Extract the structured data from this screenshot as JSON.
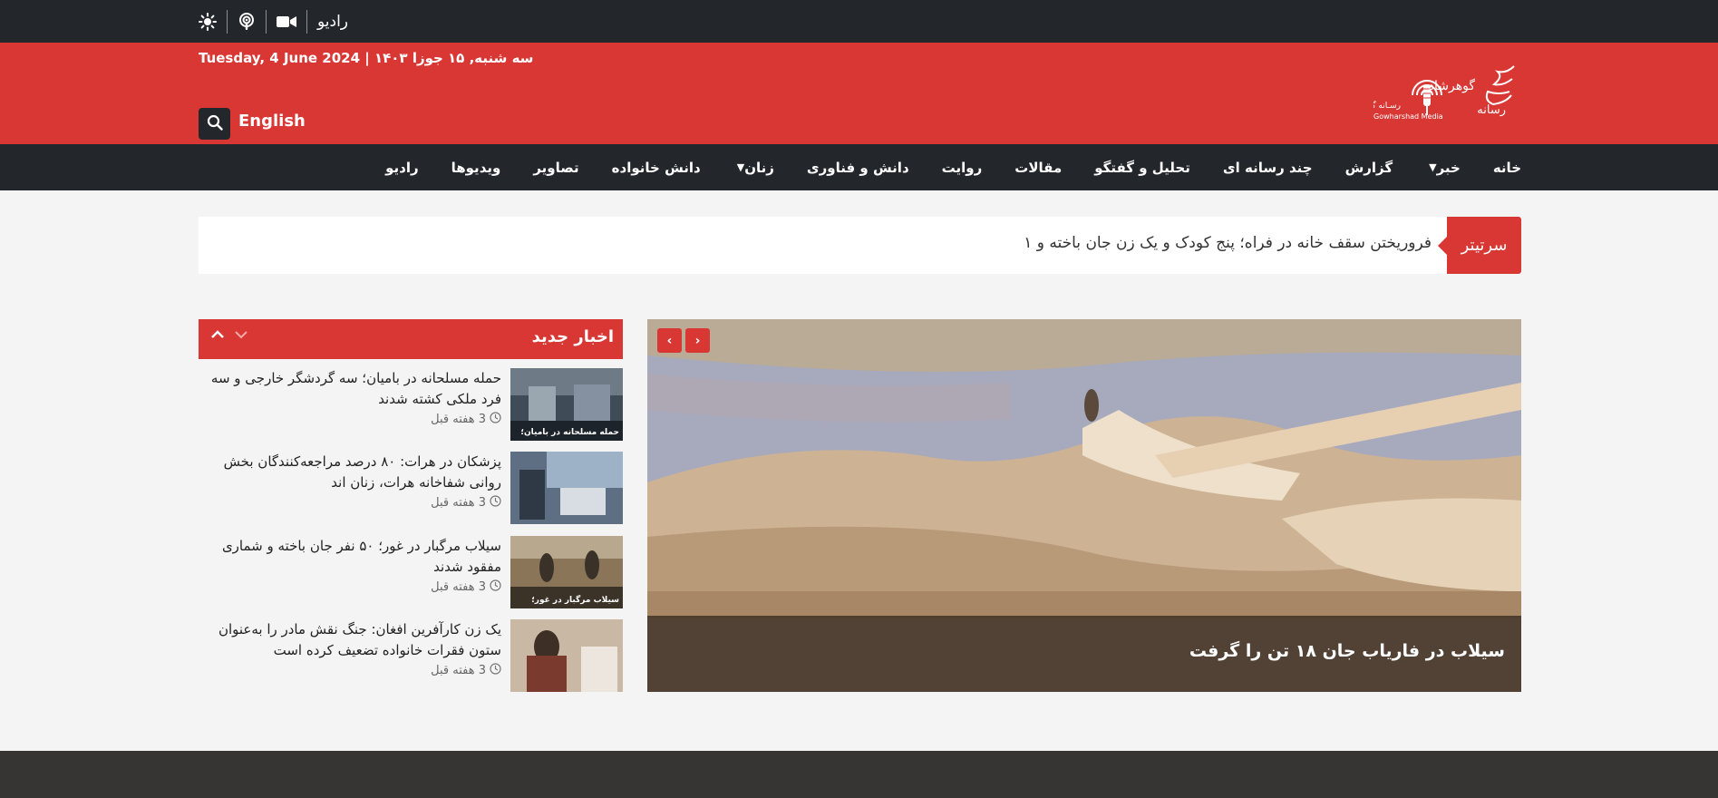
{
  "topbar": {
    "radio_label": "رادیو",
    "icons": [
      "video-icon",
      "podcast-icon",
      "sun-icon"
    ]
  },
  "header": {
    "date": "Tuesday, 4 June 2024  |  سه شنبه, ۱۵ جوزا ۱۴۰۳",
    "language_link": "English",
    "logo_text_main": "گوهرشاد",
    "logo_text_sub": "رسانه",
    "logo_text_small": "رسـانه گوهرشاد",
    "logo_text_latin": "Gowharshad Media"
  },
  "nav": {
    "items": [
      {
        "label": "خانه",
        "dropdown": false
      },
      {
        "label": "خبر",
        "dropdown": true
      },
      {
        "label": "گزارش",
        "dropdown": false
      },
      {
        "label": "چند رسانه ای",
        "dropdown": false
      },
      {
        "label": "تحلیل و گفتگو",
        "dropdown": false
      },
      {
        "label": "مقالات",
        "dropdown": false
      },
      {
        "label": "روایت",
        "dropdown": false
      },
      {
        "label": "دانش و فناوری",
        "dropdown": false
      },
      {
        "label": "زنان",
        "dropdown": true
      },
      {
        "label": "دانش خانواده",
        "dropdown": false
      },
      {
        "label": "تصاویر",
        "dropdown": false
      },
      {
        "label": "ویدیوها",
        "dropdown": false
      },
      {
        "label": "رادیو",
        "dropdown": false
      }
    ]
  },
  "ticker": {
    "label": "سرتیتر",
    "headline": "فروریختن سقف خانه در فراه؛ پنج کودک و یک زن جان باخته و ۱"
  },
  "slider": {
    "caption": "سیلاب در فاریاب جان ۱۸ تن را گرفت",
    "prev_label": "‹",
    "next_label": "›"
  },
  "latest": {
    "title": "اخبار جدید",
    "items": [
      {
        "title": "حمله مسلحانه در بامیان؛ سه گردشگر خارجی و سه فرد ملکی کشته شدند",
        "time": "3 هفته قبل",
        "thumb_caption": "حمله مسلحانه در بامیان؛"
      },
      {
        "title": "پزشکان در هرات: ۸۰ درصد مراجعه‌کنندگان بخش روانی شفاخانه هرات، زنان اند",
        "time": "3 هفته قبل",
        "thumb_caption": ""
      },
      {
        "title": "سیلاب مرگبار در غور؛ ۵۰ نفر جان باخته و شماری مفقود شدند",
        "time": "3 هفته قبل",
        "thumb_caption": "سیلاب مرگبار در غور؛"
      },
      {
        "title": "یک زن کارآفرین افغان: جنگ نقش مادر را به‌عنوان ستون فقرات خانواده تضعیف کرده است",
        "time": "3 هفته قبل",
        "thumb_caption": ""
      }
    ]
  },
  "colors": {
    "brand_red": "#d93734",
    "dark": "#23272c",
    "footer": "#363534"
  }
}
